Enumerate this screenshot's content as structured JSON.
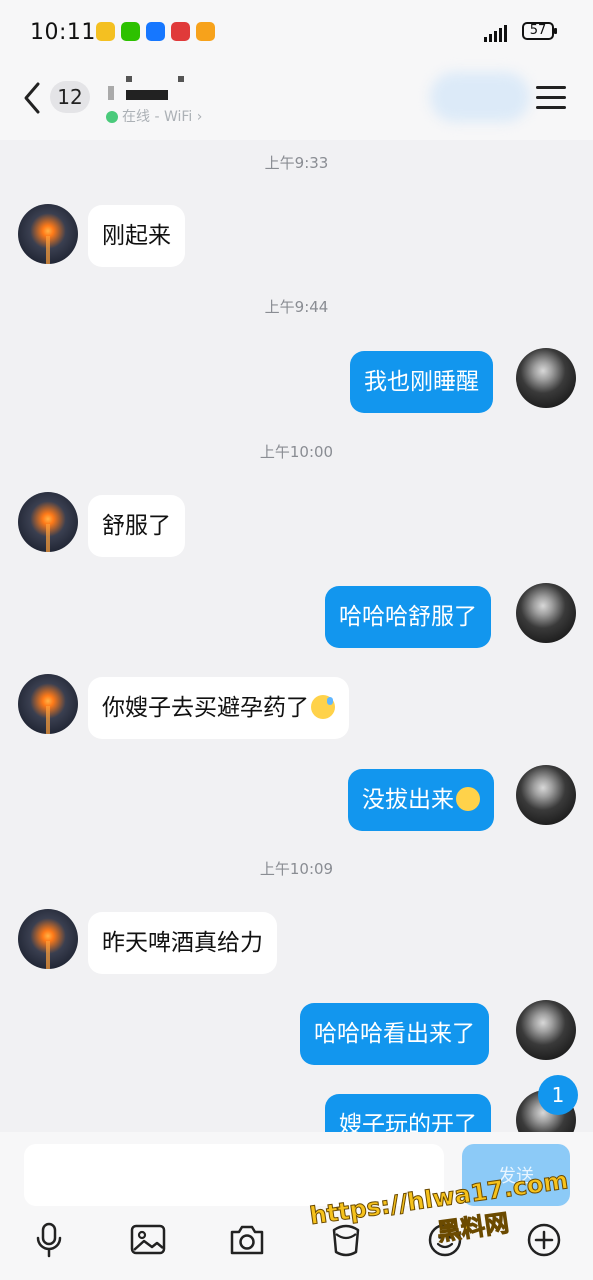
{
  "status_bar": {
    "time": "10:11",
    "battery": "57"
  },
  "header": {
    "unread_count": "12",
    "presence": "在线 - WiFi ›"
  },
  "messages": [
    {
      "kind": "time",
      "text": "上午9:33"
    },
    {
      "kind": "in",
      "text": "刚起来"
    },
    {
      "kind": "time",
      "text": "上午9:44"
    },
    {
      "kind": "out",
      "text": "我也刚睡醒"
    },
    {
      "kind": "time",
      "text": "上午10:00"
    },
    {
      "kind": "in",
      "text": "舒服了"
    },
    {
      "kind": "out",
      "text": "哈哈哈舒服了"
    },
    {
      "kind": "in",
      "text": "你嫂子去买避孕药了",
      "emoji": "cold-sweat-emoji"
    },
    {
      "kind": "out",
      "text": "没拔出来",
      "emoji": "relieved-emoji"
    },
    {
      "kind": "time",
      "text": "上午10:09"
    },
    {
      "kind": "in",
      "text": "昨天啤酒真给力"
    },
    {
      "kind": "out",
      "text": "哈哈哈看出来了"
    },
    {
      "kind": "out",
      "text": "嫂子玩的开了"
    }
  ],
  "new_message_badge": "1",
  "input": {
    "placeholder": "",
    "send_label": "发送"
  },
  "toolbar": [
    "microphone-icon",
    "image-icon",
    "camera-icon",
    "red-packet-icon",
    "emoji-icon",
    "plus-icon"
  ],
  "watermark": {
    "line1": "https://hlwa17.com",
    "line2": "黑料网"
  },
  "colors": {
    "outgoing_bubble": "#1296ee",
    "incoming_bubble": "#ffffff",
    "background": "#f1f1f3"
  }
}
